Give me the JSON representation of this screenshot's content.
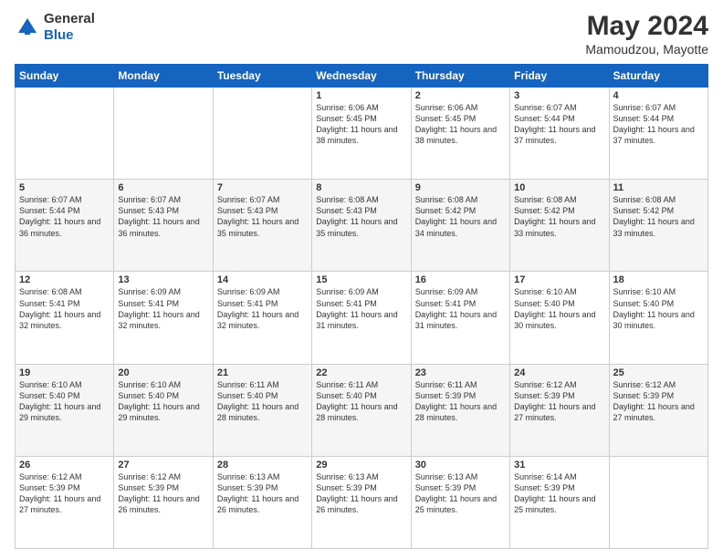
{
  "header": {
    "logo_line1": "General",
    "logo_line2": "Blue",
    "month": "May 2024",
    "location": "Mamoudzou, Mayotte"
  },
  "weekdays": [
    "Sunday",
    "Monday",
    "Tuesday",
    "Wednesday",
    "Thursday",
    "Friday",
    "Saturday"
  ],
  "weeks": [
    [
      {
        "day": "",
        "sunrise": "",
        "sunset": "",
        "daylight": ""
      },
      {
        "day": "",
        "sunrise": "",
        "sunset": "",
        "daylight": ""
      },
      {
        "day": "",
        "sunrise": "",
        "sunset": "",
        "daylight": ""
      },
      {
        "day": "1",
        "sunrise": "Sunrise: 6:06 AM",
        "sunset": "Sunset: 5:45 PM",
        "daylight": "Daylight: 11 hours and 38 minutes."
      },
      {
        "day": "2",
        "sunrise": "Sunrise: 6:06 AM",
        "sunset": "Sunset: 5:45 PM",
        "daylight": "Daylight: 11 hours and 38 minutes."
      },
      {
        "day": "3",
        "sunrise": "Sunrise: 6:07 AM",
        "sunset": "Sunset: 5:44 PM",
        "daylight": "Daylight: 11 hours and 37 minutes."
      },
      {
        "day": "4",
        "sunrise": "Sunrise: 6:07 AM",
        "sunset": "Sunset: 5:44 PM",
        "daylight": "Daylight: 11 hours and 37 minutes."
      }
    ],
    [
      {
        "day": "5",
        "sunrise": "Sunrise: 6:07 AM",
        "sunset": "Sunset: 5:44 PM",
        "daylight": "Daylight: 11 hours and 36 minutes."
      },
      {
        "day": "6",
        "sunrise": "Sunrise: 6:07 AM",
        "sunset": "Sunset: 5:43 PM",
        "daylight": "Daylight: 11 hours and 36 minutes."
      },
      {
        "day": "7",
        "sunrise": "Sunrise: 6:07 AM",
        "sunset": "Sunset: 5:43 PM",
        "daylight": "Daylight: 11 hours and 35 minutes."
      },
      {
        "day": "8",
        "sunrise": "Sunrise: 6:08 AM",
        "sunset": "Sunset: 5:43 PM",
        "daylight": "Daylight: 11 hours and 35 minutes."
      },
      {
        "day": "9",
        "sunrise": "Sunrise: 6:08 AM",
        "sunset": "Sunset: 5:42 PM",
        "daylight": "Daylight: 11 hours and 34 minutes."
      },
      {
        "day": "10",
        "sunrise": "Sunrise: 6:08 AM",
        "sunset": "Sunset: 5:42 PM",
        "daylight": "Daylight: 11 hours and 33 minutes."
      },
      {
        "day": "11",
        "sunrise": "Sunrise: 6:08 AM",
        "sunset": "Sunset: 5:42 PM",
        "daylight": "Daylight: 11 hours and 33 minutes."
      }
    ],
    [
      {
        "day": "12",
        "sunrise": "Sunrise: 6:08 AM",
        "sunset": "Sunset: 5:41 PM",
        "daylight": "Daylight: 11 hours and 32 minutes."
      },
      {
        "day": "13",
        "sunrise": "Sunrise: 6:09 AM",
        "sunset": "Sunset: 5:41 PM",
        "daylight": "Daylight: 11 hours and 32 minutes."
      },
      {
        "day": "14",
        "sunrise": "Sunrise: 6:09 AM",
        "sunset": "Sunset: 5:41 PM",
        "daylight": "Daylight: 11 hours and 32 minutes."
      },
      {
        "day": "15",
        "sunrise": "Sunrise: 6:09 AM",
        "sunset": "Sunset: 5:41 PM",
        "daylight": "Daylight: 11 hours and 31 minutes."
      },
      {
        "day": "16",
        "sunrise": "Sunrise: 6:09 AM",
        "sunset": "Sunset: 5:41 PM",
        "daylight": "Daylight: 11 hours and 31 minutes."
      },
      {
        "day": "17",
        "sunrise": "Sunrise: 6:10 AM",
        "sunset": "Sunset: 5:40 PM",
        "daylight": "Daylight: 11 hours and 30 minutes."
      },
      {
        "day": "18",
        "sunrise": "Sunrise: 6:10 AM",
        "sunset": "Sunset: 5:40 PM",
        "daylight": "Daylight: 11 hours and 30 minutes."
      }
    ],
    [
      {
        "day": "19",
        "sunrise": "Sunrise: 6:10 AM",
        "sunset": "Sunset: 5:40 PM",
        "daylight": "Daylight: 11 hours and 29 minutes."
      },
      {
        "day": "20",
        "sunrise": "Sunrise: 6:10 AM",
        "sunset": "Sunset: 5:40 PM",
        "daylight": "Daylight: 11 hours and 29 minutes."
      },
      {
        "day": "21",
        "sunrise": "Sunrise: 6:11 AM",
        "sunset": "Sunset: 5:40 PM",
        "daylight": "Daylight: 11 hours and 28 minutes."
      },
      {
        "day": "22",
        "sunrise": "Sunrise: 6:11 AM",
        "sunset": "Sunset: 5:40 PM",
        "daylight": "Daylight: 11 hours and 28 minutes."
      },
      {
        "day": "23",
        "sunrise": "Sunrise: 6:11 AM",
        "sunset": "Sunset: 5:39 PM",
        "daylight": "Daylight: 11 hours and 28 minutes."
      },
      {
        "day": "24",
        "sunrise": "Sunrise: 6:12 AM",
        "sunset": "Sunset: 5:39 PM",
        "daylight": "Daylight: 11 hours and 27 minutes."
      },
      {
        "day": "25",
        "sunrise": "Sunrise: 6:12 AM",
        "sunset": "Sunset: 5:39 PM",
        "daylight": "Daylight: 11 hours and 27 minutes."
      }
    ],
    [
      {
        "day": "26",
        "sunrise": "Sunrise: 6:12 AM",
        "sunset": "Sunset: 5:39 PM",
        "daylight": "Daylight: 11 hours and 27 minutes."
      },
      {
        "day": "27",
        "sunrise": "Sunrise: 6:12 AM",
        "sunset": "Sunset: 5:39 PM",
        "daylight": "Daylight: 11 hours and 26 minutes."
      },
      {
        "day": "28",
        "sunrise": "Sunrise: 6:13 AM",
        "sunset": "Sunset: 5:39 PM",
        "daylight": "Daylight: 11 hours and 26 minutes."
      },
      {
        "day": "29",
        "sunrise": "Sunrise: 6:13 AM",
        "sunset": "Sunset: 5:39 PM",
        "daylight": "Daylight: 11 hours and 26 minutes."
      },
      {
        "day": "30",
        "sunrise": "Sunrise: 6:13 AM",
        "sunset": "Sunset: 5:39 PM",
        "daylight": "Daylight: 11 hours and 25 minutes."
      },
      {
        "day": "31",
        "sunrise": "Sunrise: 6:14 AM",
        "sunset": "Sunset: 5:39 PM",
        "daylight": "Daylight: 11 hours and 25 minutes."
      },
      {
        "day": "",
        "sunrise": "",
        "sunset": "",
        "daylight": ""
      }
    ]
  ]
}
